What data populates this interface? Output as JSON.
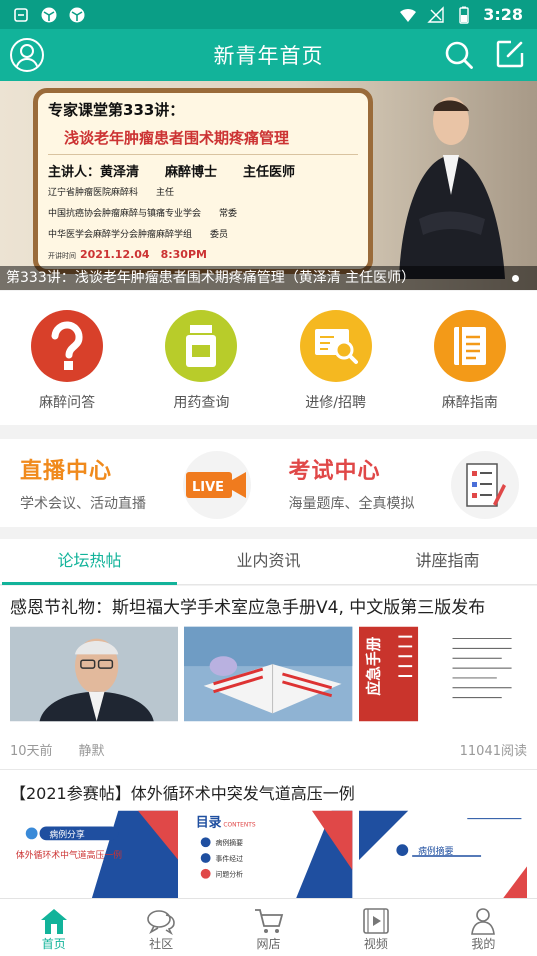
{
  "status_bar": {
    "time": "3:28"
  },
  "app_bar": {
    "title": "新青年首页"
  },
  "banner": {
    "board_title": "专家课堂第333讲：",
    "board_topic": "浅谈老年肿瘤患者围术期疼痛管理",
    "speaker_line": "主讲人：黄泽清　　麻醉博士　　主任医师",
    "affiliations": [
      "辽宁省肿瘤医院麻醉科　　主任",
      "中国抗癌协会肿瘤麻醉与镇痛专业学会　　常委",
      "中华医学会麻醉学分会肿瘤麻醉学组　　委员"
    ],
    "time_label": "开讲时间",
    "time_value": "2021.12.04　8:30PM",
    "caption": "第333讲：浅谈老年肿瘤患者围术期疼痛管理（黄泽清 主任医师）"
  },
  "quick_links": [
    {
      "label": "麻醉问答",
      "color": "#d8402a",
      "icon": "question-icon"
    },
    {
      "label": "用药查询",
      "color": "#b8cc2a",
      "icon": "medicine-bottle-icon"
    },
    {
      "label": "进修/招聘",
      "color": "#f5b820",
      "icon": "job-search-icon"
    },
    {
      "label": "麻醉指南",
      "color": "#f39a18",
      "icon": "guide-book-icon"
    }
  ],
  "promos": [
    {
      "title": "直播中心",
      "subtitle": "学术会议、活动直播",
      "icon": "live-icon"
    },
    {
      "title": "考试中心",
      "subtitle": "海量题库、全真模拟",
      "icon": "exam-checklist-icon"
    }
  ],
  "tabs": [
    "论坛热帖",
    "业内资讯",
    "讲座指南"
  ],
  "posts": [
    {
      "title": "感恩节礼物：斯坦福大学手术室应急手册V4, 中文版第三版发布",
      "time": "10天前",
      "author": "静默",
      "reads": "11041阅读"
    },
    {
      "title": "【2021参赛帖】体外循环术中突发气道高压一例",
      "thumb1_tag": "病例分享",
      "thumb1_text": "体外循环术中气道高压一例",
      "thumb2_title": "目录",
      "thumb2_sub": "CONTENTS",
      "thumb2_items": [
        "病例摘要",
        "事件经过",
        "问题分析"
      ],
      "thumb3_text": "病例摘要"
    }
  ],
  "bottom_nav": [
    "首页",
    "社区",
    "网店",
    "视频",
    "我的"
  ],
  "colors": {
    "primary": "#12b39a",
    "status_bar": "#0a9e86"
  }
}
